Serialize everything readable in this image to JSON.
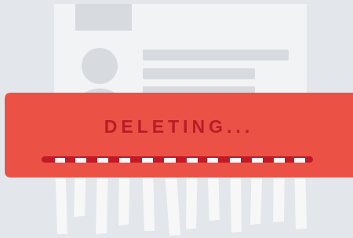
{
  "status": {
    "text": "DELETING..."
  },
  "colors": {
    "background": "#e3e6ea",
    "document": "#f2f3f5",
    "placeholder": "#d7dadf",
    "shredder_body": "#ec5146",
    "shredder_slot": "#c01a26",
    "label": "#b91c25",
    "paper_strip": "#f7f7f8"
  },
  "icons": {
    "avatar": "user-avatar-icon"
  }
}
